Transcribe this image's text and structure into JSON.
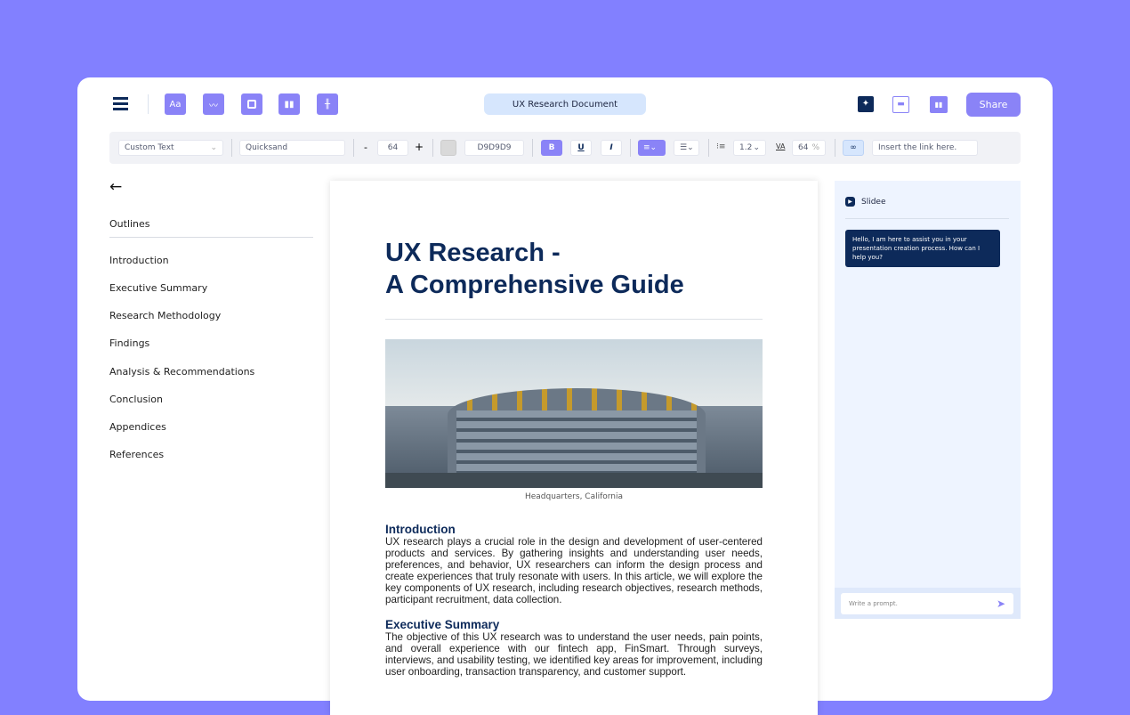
{
  "header": {
    "title": "UX Research Document",
    "share_label": "Share",
    "tools": [
      "text-tool-icon",
      "image-tool-icon",
      "shape-tool-icon",
      "chart-tool-icon",
      "table-tool-icon"
    ],
    "right_icons": [
      "ai-sparkle-icon",
      "comment-icon",
      "analytics-icon"
    ],
    "text_tool_glyph": "Aa"
  },
  "format_bar": {
    "text_style": "Custom Text",
    "font": "Quicksand",
    "minus": "-",
    "font_size": "64",
    "plus": "+",
    "color_hex": "D9D9D9",
    "swatch": "#D9D9D9",
    "bold": "B",
    "underline": "U",
    "italic": "I",
    "line_height": "1.2",
    "letter_spacing": "64",
    "percent": "%",
    "link_placeholder": "Insert the link here."
  },
  "sidebar": {
    "title": "Outlines",
    "items": [
      "Introduction",
      "Executive Summary",
      "Research Methodology",
      "Findings",
      "Analysis & Recommendations",
      "Conclusion",
      "Appendices",
      "References"
    ]
  },
  "document": {
    "title_line1": "UX Research -",
    "title_line2": "A Comprehensive Guide",
    "image_caption": "Headquarters, California",
    "sections": [
      {
        "heading": "Introduction",
        "body": "UX research plays a crucial role in the design and development of user-centered products and services. By gathering insights and understanding user needs, preferences, and behavior, UX researchers can inform the design process and create experiences that truly resonate with users. In this article, we will explore the key components of UX research, including research objectives, research methods, participant recruitment, data collection."
      },
      {
        "heading": "Executive Summary",
        "body": "The objective of this UX research was to understand the user needs, pain points, and overall experience with our fintech app, FinSmart. Through surveys, interviews, and usability testing, we identified key areas for improvement, including user onboarding, transaction transparency, and customer support."
      }
    ]
  },
  "chat": {
    "title": "Slidee",
    "message": "Hello, I am here to assist you in your presentation creation process. How can I help you?",
    "prompt_placeholder": "Write a prompt."
  },
  "colors": {
    "background": "#8280ff",
    "accent": "#8a83f7",
    "navy": "#0d2a5a",
    "chat_bg": "#eef4ff"
  }
}
